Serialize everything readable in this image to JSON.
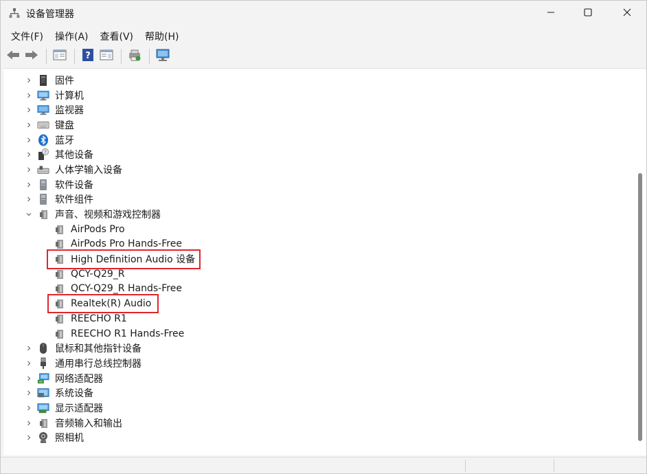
{
  "window": {
    "title": "设备管理器",
    "minimize_icon": "minimize-icon",
    "maximize_icon": "maximize-icon",
    "close_icon": "close-icon"
  },
  "menu": {
    "items": [
      "文件(F)",
      "操作(A)",
      "查看(V)",
      "帮助(H)"
    ]
  },
  "toolbar": {
    "buttons": [
      "back-arrow-icon",
      "forward-arrow-icon",
      "show-hide-console-tree-icon",
      "help-icon",
      "properties-icon",
      "update-driver-icon",
      "scan-hardware-icon"
    ]
  },
  "tree": {
    "categories_before": [
      {
        "label": "固件",
        "icon": "firmware-icon"
      },
      {
        "label": "计算机",
        "icon": "computer-icon"
      },
      {
        "label": "监视器",
        "icon": "monitor-icon"
      },
      {
        "label": "键盘",
        "icon": "keyboard-icon"
      },
      {
        "label": "蓝牙",
        "icon": "bluetooth-icon"
      },
      {
        "label": "其他设备",
        "icon": "unknown-device-icon"
      },
      {
        "label": "人体学输入设备",
        "icon": "hid-icon"
      },
      {
        "label": "软件设备",
        "icon": "software-device-icon"
      },
      {
        "label": "软件组件",
        "icon": "software-component-icon"
      }
    ],
    "expanded_category": {
      "label": "声音、视频和游戏控制器",
      "icon": "speaker-icon"
    },
    "audio_children": [
      {
        "label": "AirPods Pro"
      },
      {
        "label": "AirPods Pro Hands-Free"
      },
      {
        "label": "High Definition Audio 设备",
        "highlighted": true
      },
      {
        "label": "QCY-Q29_R"
      },
      {
        "label": "QCY-Q29_R Hands-Free"
      },
      {
        "label": "Realtek(R) Audio",
        "highlighted": true
      },
      {
        "label": "REECHO R1"
      },
      {
        "label": "REECHO R1 Hands-Free"
      }
    ],
    "categories_after": [
      {
        "label": "鼠标和其他指针设备",
        "icon": "mouse-icon"
      },
      {
        "label": "通用串行总线控制器",
        "icon": "usb-icon"
      },
      {
        "label": "网络适配器",
        "icon": "network-adapter-icon"
      },
      {
        "label": "系统设备",
        "icon": "system-device-icon"
      },
      {
        "label": "显示适配器",
        "icon": "display-adapter-icon"
      },
      {
        "label": "音频输入和输出",
        "icon": "audio-io-icon"
      },
      {
        "label": "照相机",
        "icon": "camera-icon"
      }
    ]
  },
  "colors": {
    "highlight_box": "#e0252b",
    "tree_background": "#ffffff",
    "chrome_background": "#f3f3f3"
  }
}
